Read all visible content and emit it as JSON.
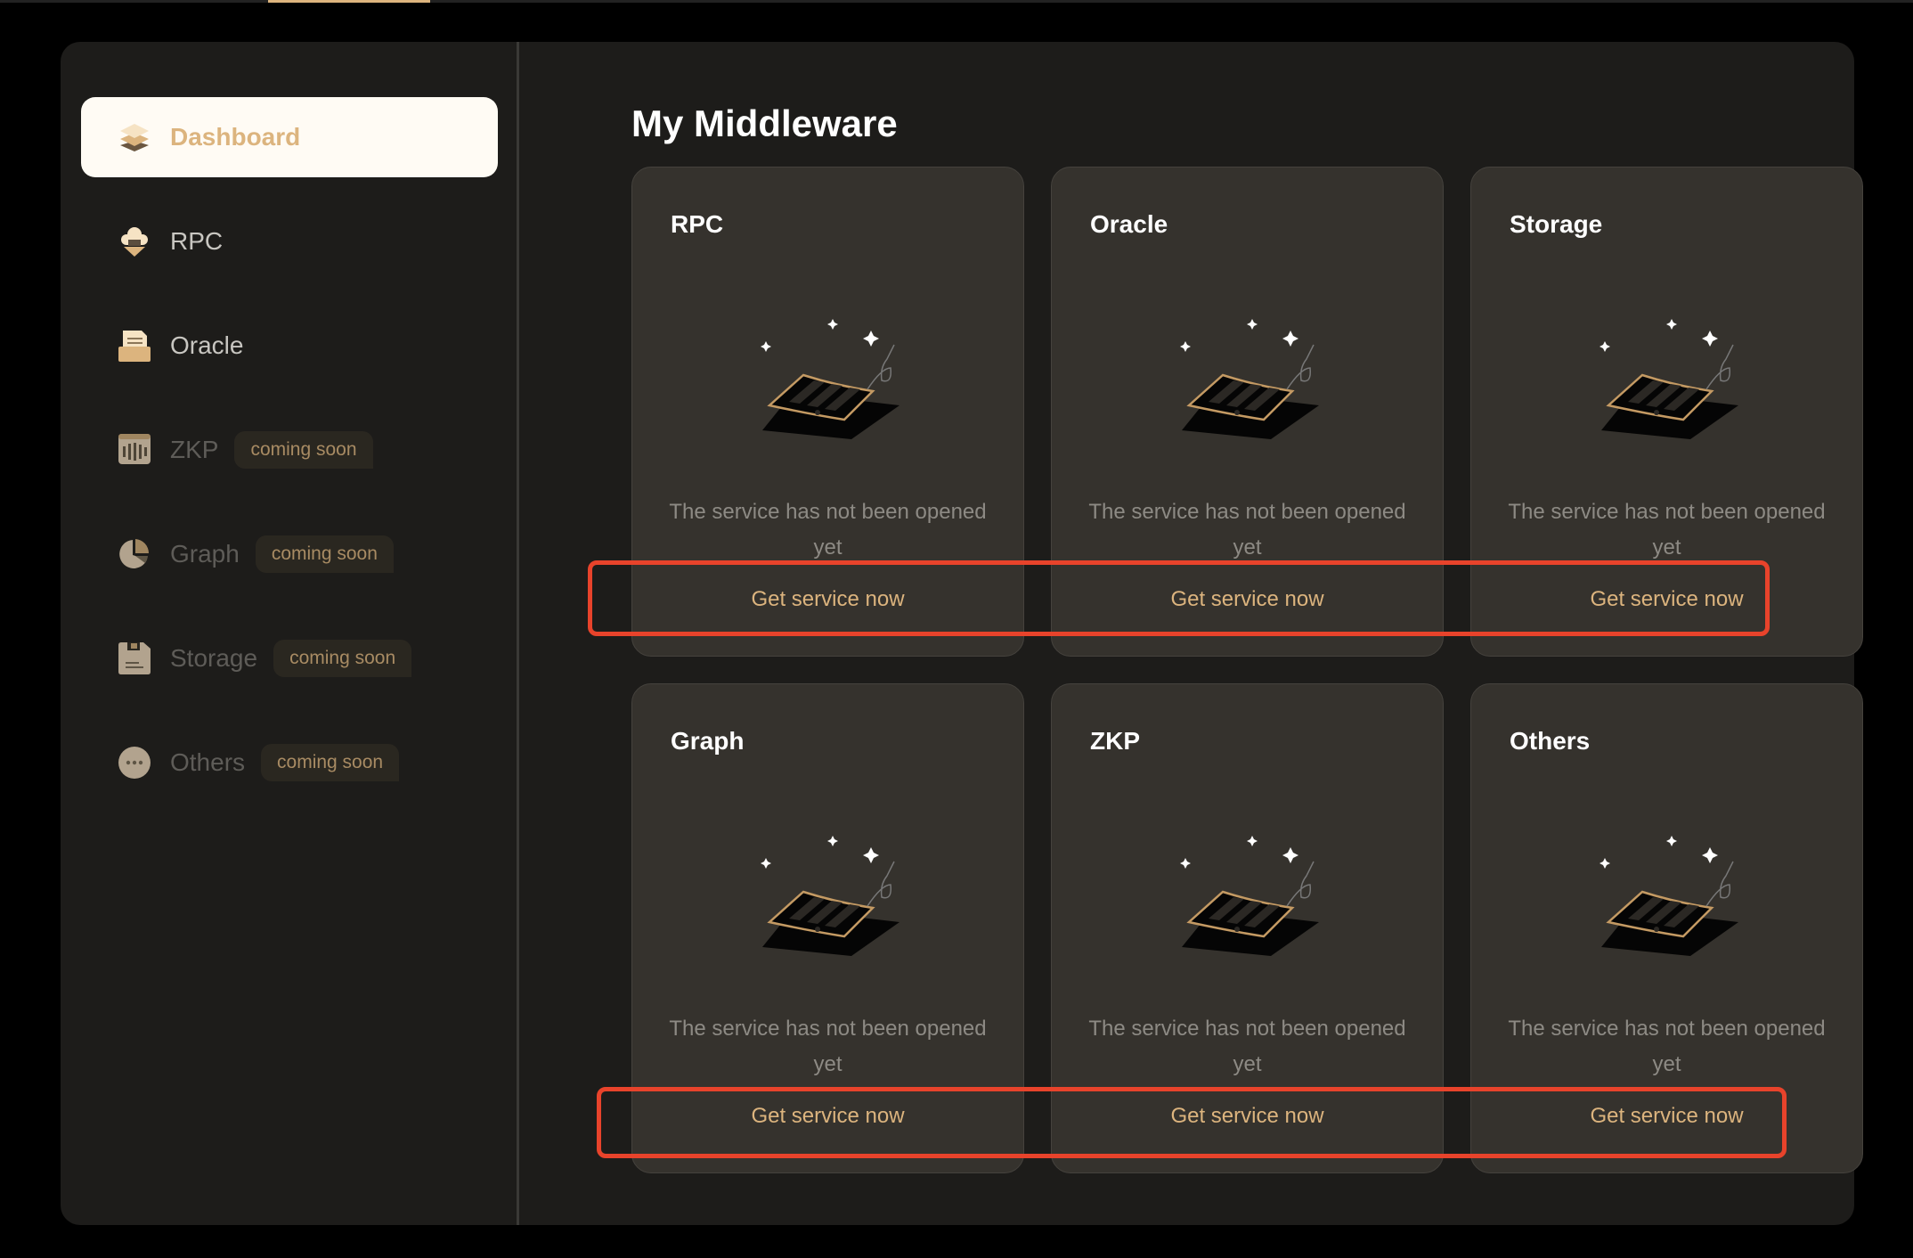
{
  "topnav": {
    "active_indicator_color": "#dcb47e"
  },
  "sidebar": {
    "items": [
      {
        "label": "Dashboard",
        "icon": "layers-icon",
        "active": true,
        "badge": null
      },
      {
        "label": "RPC",
        "icon": "cloud-download-icon",
        "active": false,
        "badge": null
      },
      {
        "label": "Oracle",
        "icon": "inbox-document-icon",
        "active": false,
        "badge": null
      },
      {
        "label": "ZKP",
        "icon": "bar-signal-icon",
        "active": false,
        "badge": "coming soon"
      },
      {
        "label": "Graph",
        "icon": "pie-chart-icon",
        "active": false,
        "badge": "coming soon"
      },
      {
        "label": "Storage",
        "icon": "floppy-disk-icon",
        "active": false,
        "badge": "coming soon"
      },
      {
        "label": "Others",
        "icon": "more-dots-icon",
        "active": false,
        "badge": "coming soon"
      }
    ]
  },
  "main": {
    "title": "My Middleware",
    "cards": [
      {
        "title": "RPC",
        "message": "The service has not been opened yet",
        "button": "Get service now",
        "illustration": "empty-document-icon"
      },
      {
        "title": "Oracle",
        "message": "The service has not been opened yet",
        "button": "Get service now",
        "illustration": "empty-document-icon"
      },
      {
        "title": "Storage",
        "message": "The service has not been opened yet",
        "button": "Get service now",
        "illustration": "empty-document-icon"
      },
      {
        "title": "Graph",
        "message": "The service has not been opened yet",
        "button": "Get service now",
        "illustration": "empty-document-icon"
      },
      {
        "title": "ZKP",
        "message": "The service has not been opened yet",
        "button": "Get service now",
        "illustration": "empty-document-icon"
      },
      {
        "title": "Others",
        "message": "The service has not been opened yet",
        "button": "Get service now",
        "illustration": "empty-document-icon"
      }
    ]
  },
  "colors": {
    "accent": "#dcb47e",
    "highlight": "#e8432b",
    "card_bg": "#35322d",
    "panel_bg": "#1d1c1a"
  }
}
